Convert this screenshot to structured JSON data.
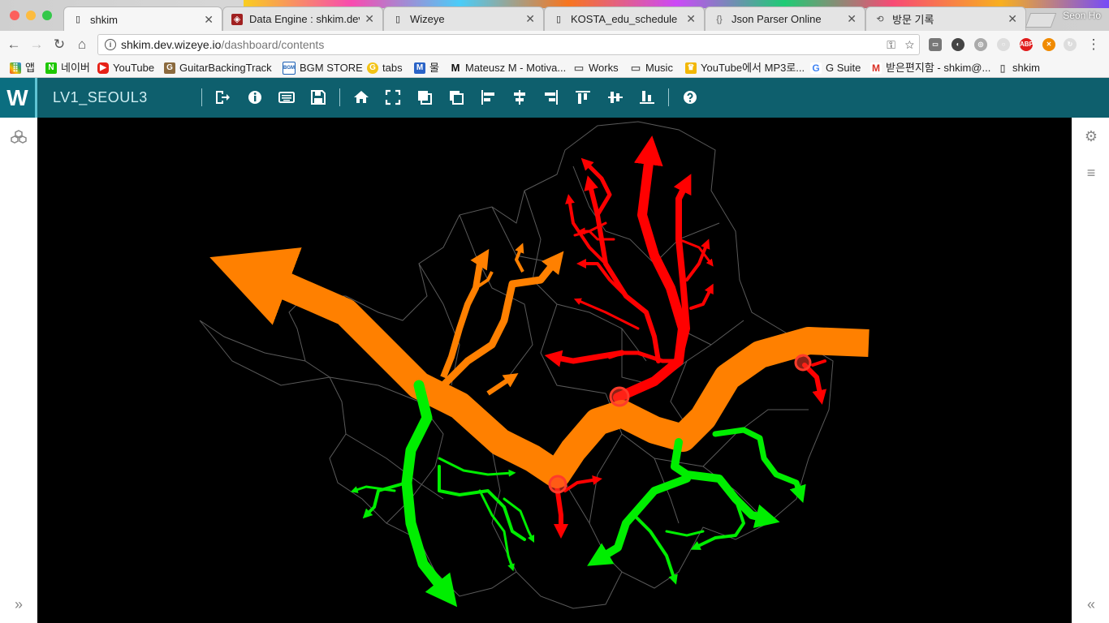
{
  "browser": {
    "tabs": [
      {
        "title": "shkim",
        "icon": "page-icon",
        "active": true
      },
      {
        "title": "Data Engine : shkim.dev.",
        "icon": "data-engine-favicon"
      },
      {
        "title": "Wizeye",
        "icon": "page-icon"
      },
      {
        "title": "KOSTA_edu_schedule",
        "icon": "page-icon"
      },
      {
        "title": "Json Parser Online",
        "icon": "json-favicon"
      },
      {
        "title": "방문 기록",
        "icon": "history-icon"
      }
    ],
    "profile_name": "Seon Ho",
    "url_host": "shkim.dev.wizeye.io",
    "url_path": "/dashboard/contents",
    "bookmarks": [
      {
        "label": "앱",
        "icon": "apps-grid-icon"
      },
      {
        "label": "네이버",
        "icon": "naver-icon"
      },
      {
        "label": "YouTube",
        "icon": "youtube-icon"
      },
      {
        "label": "GuitarBackingTrack",
        "icon": "guitar-icon"
      },
      {
        "label": "BGM STORE",
        "icon": "bgm-store-icon"
      },
      {
        "label": "tabs",
        "icon": "tabs-icon"
      },
      {
        "label": "물",
        "icon": "m-icon"
      },
      {
        "label": "Mateusz M - Motiva...",
        "icon": "medium-icon"
      },
      {
        "label": "Works",
        "icon": "folder-icon"
      },
      {
        "label": "Music",
        "icon": "folder-icon"
      },
      {
        "label": "YouTube에서 MP3로...",
        "icon": "mp3-icon"
      },
      {
        "label": "G Suite",
        "icon": "google-icon"
      },
      {
        "label": "받은편지함 - shkim@...",
        "icon": "gmail-icon"
      },
      {
        "label": "shkim",
        "icon": "page-icon"
      }
    ]
  },
  "app": {
    "logo": "W",
    "title": "LV1_SEOUL3",
    "toolbar_icons": [
      "exit-icon",
      "info-icon",
      "keyboard-icon",
      "save-icon",
      "home-icon",
      "fullscreen-icon",
      "bring-front-icon",
      "send-back-icon",
      "align-left-icon",
      "align-center-h-icon",
      "align-right-icon",
      "align-top-icon",
      "align-middle-v-icon",
      "align-bottom-icon",
      "help-icon"
    ],
    "left_panel_icons": [
      "cubes-icon",
      "expand-right-icon"
    ],
    "right_panel_icons": [
      "settings-icon",
      "menu-icon",
      "collapse-left-icon"
    ]
  },
  "map": {
    "colors": {
      "background": "#000000",
      "orange": "#ff8000",
      "red": "#ff0000",
      "green": "#00ee00",
      "district_lines": "#5a5a5a"
    }
  }
}
